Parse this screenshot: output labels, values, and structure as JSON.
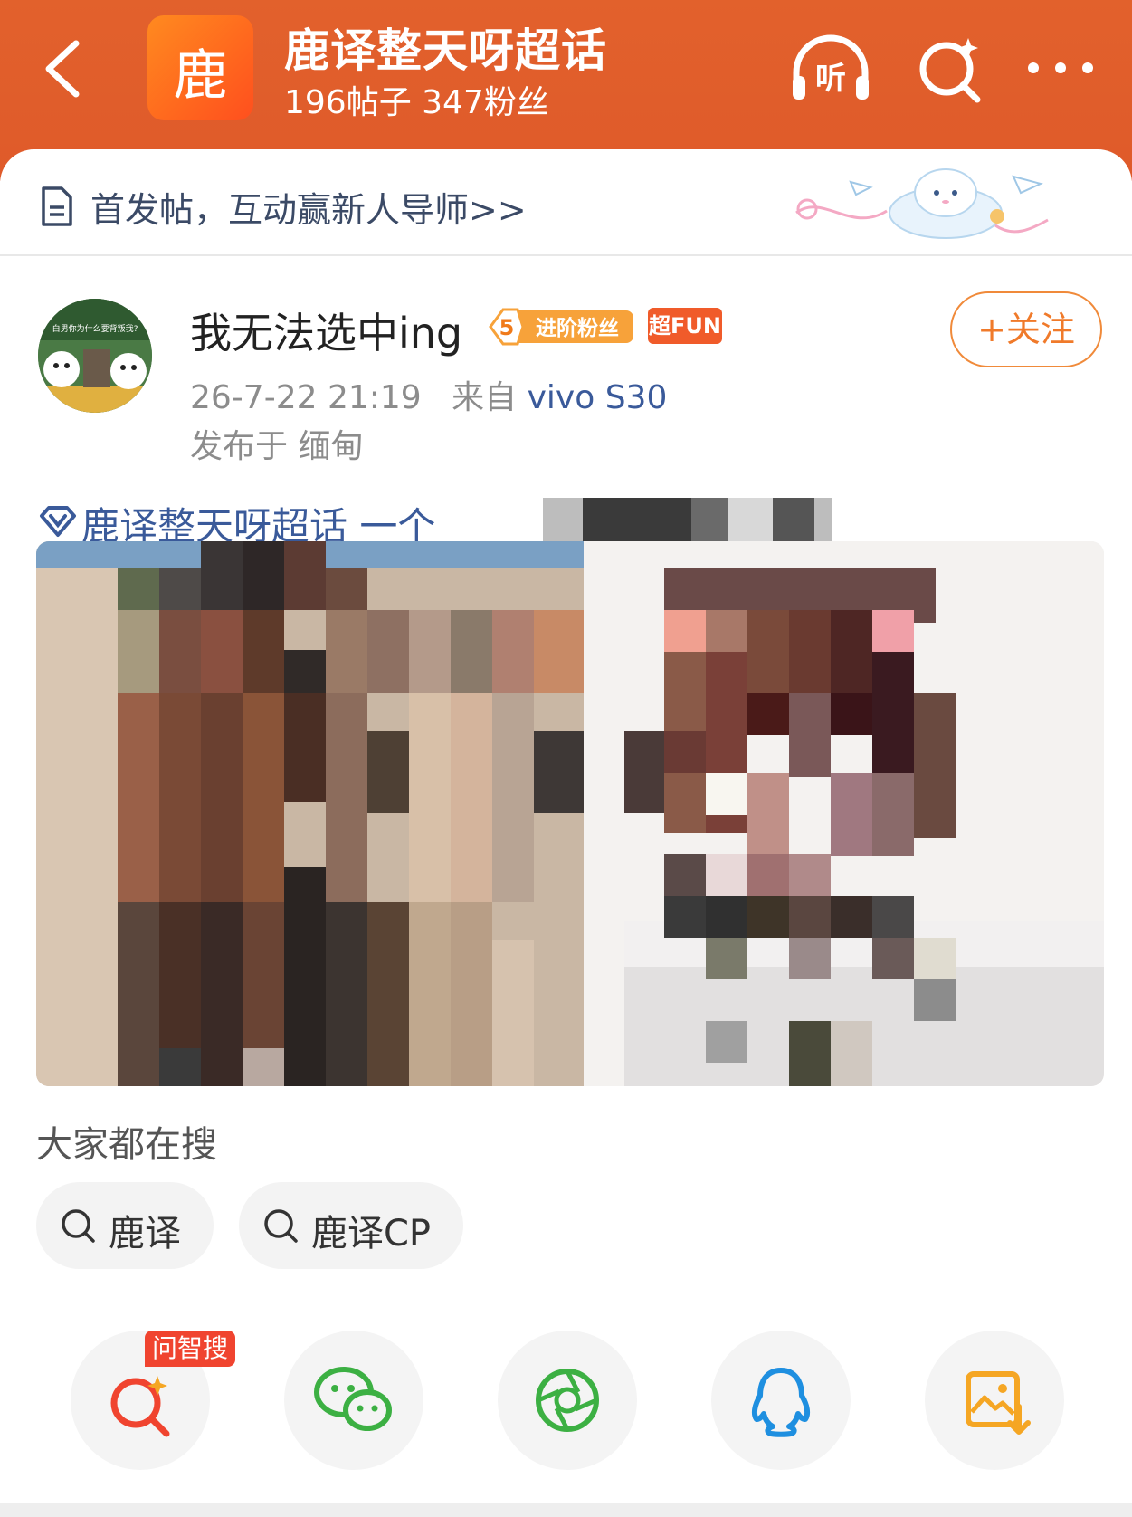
{
  "header": {
    "avatar_char": "鹿",
    "title": "鹿译整天呀超话",
    "subtitle": "196帖子 347粉丝",
    "listen_label": "听"
  },
  "banner": {
    "text": "首发帖，互动赢新人导师>>"
  },
  "post": {
    "username": "我无法选中ing",
    "level_number": "5",
    "level_badge": "进阶粉丝",
    "fun_badge": "超FUN",
    "avatar_caption": "白男你为什么要背叛我?",
    "time": "26-7-22 21:19",
    "from_label": "来自",
    "device": "vivo S30",
    "location": "发布于 缅甸",
    "follow_label": "+关注",
    "topic_text": "鹿译整天呀超话 一个"
  },
  "search_section": {
    "title": "大家都在搜",
    "chips": [
      "鹿译",
      "鹿译CP"
    ]
  },
  "share": {
    "badge_label": "问智搜"
  },
  "colors": {
    "header_bg": "#e2612c",
    "link_blue": "#3a5a9a",
    "accent_orange": "#f07a2a",
    "badge_red": "#f0442f"
  }
}
